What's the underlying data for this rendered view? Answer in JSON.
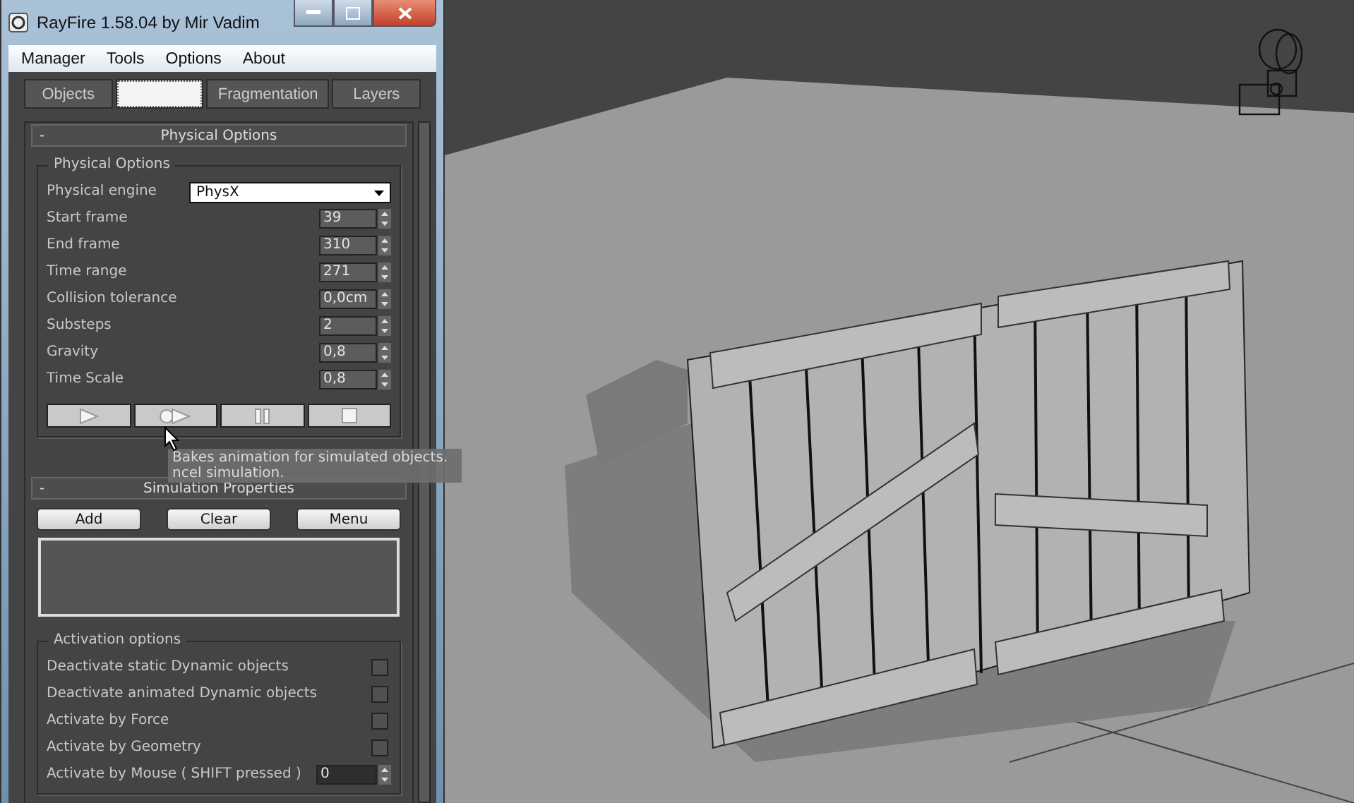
{
  "window": {
    "title": "RayFire 1.58.04  by Mir Vadim"
  },
  "menu": [
    "Manager",
    "Tools",
    "Options",
    "About"
  ],
  "tabs": [
    {
      "label": "Objects",
      "selected": false
    },
    {
      "selected": true
    },
    {
      "label": "Fragmentation",
      "selected": false
    },
    {
      "label": "Layers",
      "selected": false
    }
  ],
  "physical_rollout": {
    "toggle": "-",
    "title": "Physical Options",
    "group_title": "Physical Options",
    "engine": {
      "label": "Physical engine",
      "value": "PhysX"
    },
    "spinners": [
      {
        "label": "Start frame",
        "value": "39"
      },
      {
        "label": "End frame",
        "value": "310"
      },
      {
        "label": "Time range",
        "value": "271"
      },
      {
        "label": "Collision tolerance",
        "value": "0,0cm"
      },
      {
        "label": "Substeps",
        "value": "2"
      },
      {
        "label": "Gravity",
        "value": "0,8"
      },
      {
        "label": "Time Scale",
        "value": "0,8"
      }
    ],
    "playback": [
      {
        "kind": "play"
      },
      {
        "kind": "bake"
      },
      {
        "kind": "pause"
      },
      {
        "kind": "stop"
      }
    ]
  },
  "tooltip": [
    "Bakes animation for simulated objects.",
    "ncel simulation."
  ],
  "simulation_rollout": {
    "toggle": "-",
    "title": "Simulation Properties",
    "buttons": [
      "Add",
      "Clear",
      "Menu"
    ]
  },
  "activation": {
    "title": "Activation options",
    "options": [
      {
        "kind": "checkbox",
        "label": "Deactivate static Dynamic objects",
        "checked": false
      },
      {
        "kind": "checkbox",
        "label": "Deactivate animated Dynamic objects",
        "checked": false
      },
      {
        "kind": "checkbox",
        "label": "Activate by Force",
        "checked": false
      },
      {
        "kind": "checkbox",
        "label": "Activate by Geometry",
        "checked": false
      },
      {
        "kind": "spinner",
        "label": "Activate by Mouse ( SHIFT pressed )",
        "value": "0"
      }
    ]
  }
}
